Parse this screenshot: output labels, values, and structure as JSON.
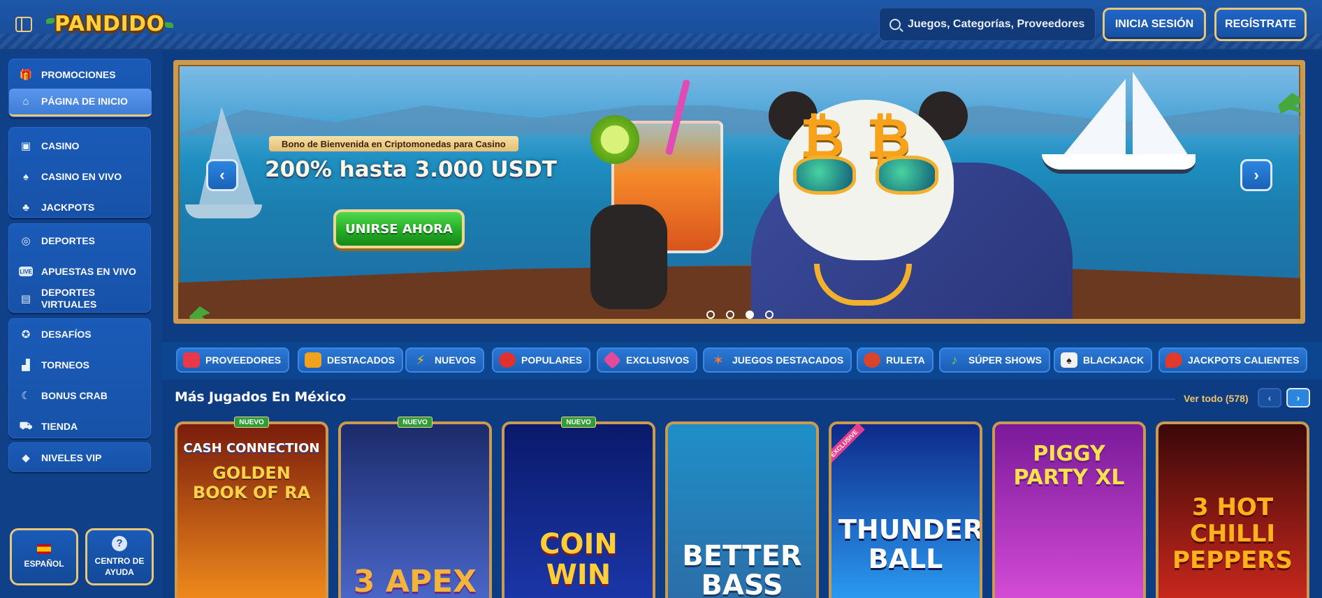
{
  "header": {
    "logo_text": "PANDIDO",
    "search_placeholder": "Juegos, Categorías, Proveedores",
    "login_label": "INICIA SESIÓN",
    "register_label": "REGÍSTRATE"
  },
  "sidebar": {
    "groups": [
      {
        "items": [
          {
            "label": "PROMOCIONES",
            "icon": "gift-icon"
          },
          {
            "label": "PÁGINA DE INICIO",
            "icon": "home-icon",
            "active": true
          }
        ]
      },
      {
        "items": [
          {
            "label": "CASINO",
            "icon": "slot-machine-icon"
          },
          {
            "label": "CASINO EN VIVO",
            "icon": "live-cards-icon"
          },
          {
            "label": "JACKPOTS",
            "icon": "clover-icon"
          }
        ]
      },
      {
        "items": [
          {
            "label": "DEPORTES",
            "icon": "basketball-icon"
          },
          {
            "label": "APUESTAS EN VIVO",
            "icon": "live-icon"
          },
          {
            "label": "DEPORTES VIRTUALES",
            "icon": "virtual-sports-icon"
          }
        ]
      },
      {
        "items": [
          {
            "label": "DESAFÍOS",
            "icon": "medal-icon"
          },
          {
            "label": "TORNEOS",
            "icon": "podium-icon"
          },
          {
            "label": "BONUS CRAB",
            "icon": "crab-claw-icon"
          },
          {
            "label": "TIENDA",
            "icon": "shopping-bag-icon"
          }
        ]
      },
      {
        "items": [
          {
            "label": "NIVELES VIP",
            "icon": "diamond-icon"
          }
        ]
      }
    ],
    "language_label": "ESPAÑOL",
    "help_label": "CENTRO DE AYUDA"
  },
  "banner": {
    "tag": "Bono de Bienvenida en Criptomonedas para Casino",
    "headline": "200% hasta 3.000 USDT",
    "cta": "UNIRSE AHORA",
    "slide_count": 4,
    "active_slide": 3
  },
  "categories": [
    {
      "label": "PROVEEDORES",
      "icon": "cards-icon",
      "color": "#e8384a"
    },
    {
      "label": "DESTACADOS",
      "icon": "star-burst-icon",
      "color": "#f0a21c"
    },
    {
      "label": "NUEVOS",
      "icon": "lightning-icon",
      "color": "#f5c518"
    },
    {
      "label": "POPULARES",
      "icon": "cherries-icon",
      "color": "#e0312f"
    },
    {
      "label": "EXCLUSIVOS",
      "icon": "gem-icon",
      "color": "#e44a9c"
    },
    {
      "label": "JUEGOS DESTACADOS",
      "icon": "starfish-icon",
      "color": "#f27a3a"
    },
    {
      "label": "RULETA",
      "icon": "roulette-icon",
      "color": "#d8452b"
    },
    {
      "label": "SÚPER SHOWS",
      "icon": "microphone-icon",
      "color": "#7fcf3a"
    },
    {
      "label": "BLACKJACK",
      "icon": "playing-cards-icon",
      "color": "#f2f2f2"
    },
    {
      "label": "JACKPOTS CALIENTES",
      "icon": "chili-icon",
      "color": "#e23a2a"
    }
  ],
  "section": {
    "title": "Más Jugados En México",
    "view_all": "Ver todo (578)"
  },
  "games": [
    {
      "title_top": "CASH CONNECTION",
      "title": "GOLDEN BOOK OF RA",
      "badge": "NUEVO",
      "bg1": "#7a1d0c",
      "bg2": "#f08a1c",
      "title_color": "#ffd24a"
    },
    {
      "title": "3 APEX",
      "badge": "NUEVO",
      "bg1": "#1b2b6b",
      "bg2": "#4a66c8",
      "title_color": "#f2b43a"
    },
    {
      "title": "COIN WIN",
      "badge": "NUEVO",
      "bg1": "#0a1a6a",
      "bg2": "#1b36a8",
      "title_color": "#ffcf3a"
    },
    {
      "title": "BETTER BASS",
      "badge": "",
      "bg1": "#1f8fc8",
      "bg2": "#2b6ea8",
      "title_color": "#ffffff"
    },
    {
      "title": "THUNDER BALL",
      "badge": "EXCLUSIVE",
      "bg1": "#0e2a8a",
      "bg2": "#2a9af0",
      "title_color": "#ffffff"
    },
    {
      "title": "PIGGY PARTY XL",
      "badge": "",
      "bg1": "#7a1a9a",
      "bg2": "#d44cd6",
      "title_color": "#ffe14a"
    },
    {
      "title": "3 HOT CHILLI PEPPERS",
      "badge": "",
      "bg1": "#3a0808",
      "bg2": "#c8281c",
      "title_color": "#ffb21c"
    }
  ]
}
